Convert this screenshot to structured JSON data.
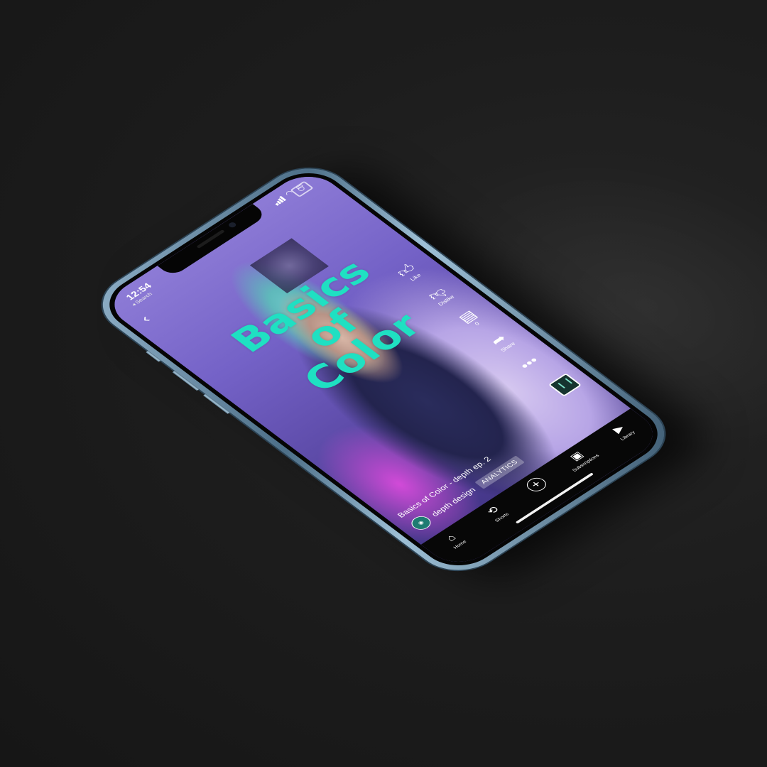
{
  "status_bar": {
    "time": "12:54",
    "back_app": "◂ Search"
  },
  "overlay": {
    "line1": "Basics",
    "line2": "of",
    "line3": "Color"
  },
  "actions": {
    "like": "Like",
    "dislike": "Dislike",
    "comments": "0",
    "share": "Share"
  },
  "video": {
    "title": "Basics of Color - depth ep. 2",
    "channel": "depth design",
    "analytics_label": "ANALYTICS"
  },
  "tabs": {
    "home": "Home",
    "shorts": "Shorts",
    "subscriptions": "Subscriptions",
    "library": "Library"
  },
  "colors": {
    "accent": "#1fe0c2",
    "frame": "#6f90a8"
  }
}
